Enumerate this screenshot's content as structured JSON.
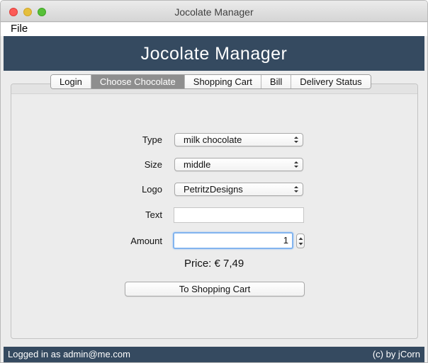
{
  "window": {
    "title": "Jocolate Manager"
  },
  "menubar": {
    "file_label": "File"
  },
  "header": {
    "title": "Jocolate Manager"
  },
  "tabs": [
    {
      "label": "Login",
      "active": false
    },
    {
      "label": "Choose Chocolate",
      "active": true
    },
    {
      "label": "Shopping Cart",
      "active": false
    },
    {
      "label": "Bill",
      "active": false
    },
    {
      "label": "Delivery Status",
      "active": false
    }
  ],
  "form": {
    "type": {
      "label": "Type",
      "value": "milk chocolate"
    },
    "size": {
      "label": "Size",
      "value": "middle"
    },
    "logo": {
      "label": "Logo",
      "value": "PetritzDesigns"
    },
    "text": {
      "label": "Text",
      "value": ""
    },
    "amount": {
      "label": "Amount",
      "value": "1"
    }
  },
  "price_text": "Price: € 7,49",
  "cart_button_label": "To Shopping Cart",
  "status": {
    "logged_in": "Logged in as admin@me.com",
    "copyright": "(c) by jCorn"
  },
  "colors": {
    "header_bg": "#354a60",
    "active_tab_bg": "#8e8e8e",
    "focus_ring": "#82b4ef",
    "close": "#fc5b57",
    "minimize": "#e5bf3c",
    "maximize": "#57c038"
  }
}
